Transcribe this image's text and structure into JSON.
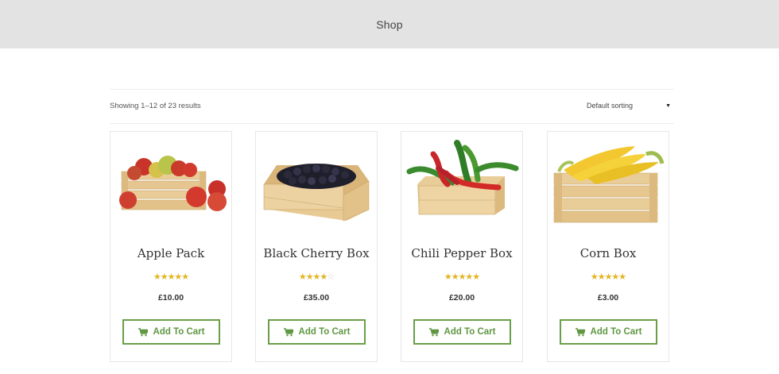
{
  "header": {
    "title": "Shop"
  },
  "toolbar": {
    "result_count": "Showing 1–12 of 23 results",
    "sort_label": "Default sorting",
    "sort_caret": "▼"
  },
  "colors": {
    "accent": "#6a9e48",
    "star": "#e2b522",
    "header_bg": "#e3e3e3"
  },
  "products": [
    {
      "name": "Apple Pack",
      "price": "£10.00",
      "rating": 4.75,
      "button": "Add To Cart",
      "image_icon": "apple-crate-image"
    },
    {
      "name": "Black Cherry Box",
      "price": "£35.00",
      "rating": 4.25,
      "button": "Add To Cart",
      "image_icon": "black-cherry-crate-image"
    },
    {
      "name": "Chili Pepper Box",
      "price": "£20.00",
      "rating": 5,
      "button": "Add To Cart",
      "image_icon": "chili-pepper-crate-image"
    },
    {
      "name": "Corn Box",
      "price": "£3.00",
      "rating": 5,
      "button": "Add To Cart",
      "image_icon": "corn-crate-image"
    }
  ]
}
